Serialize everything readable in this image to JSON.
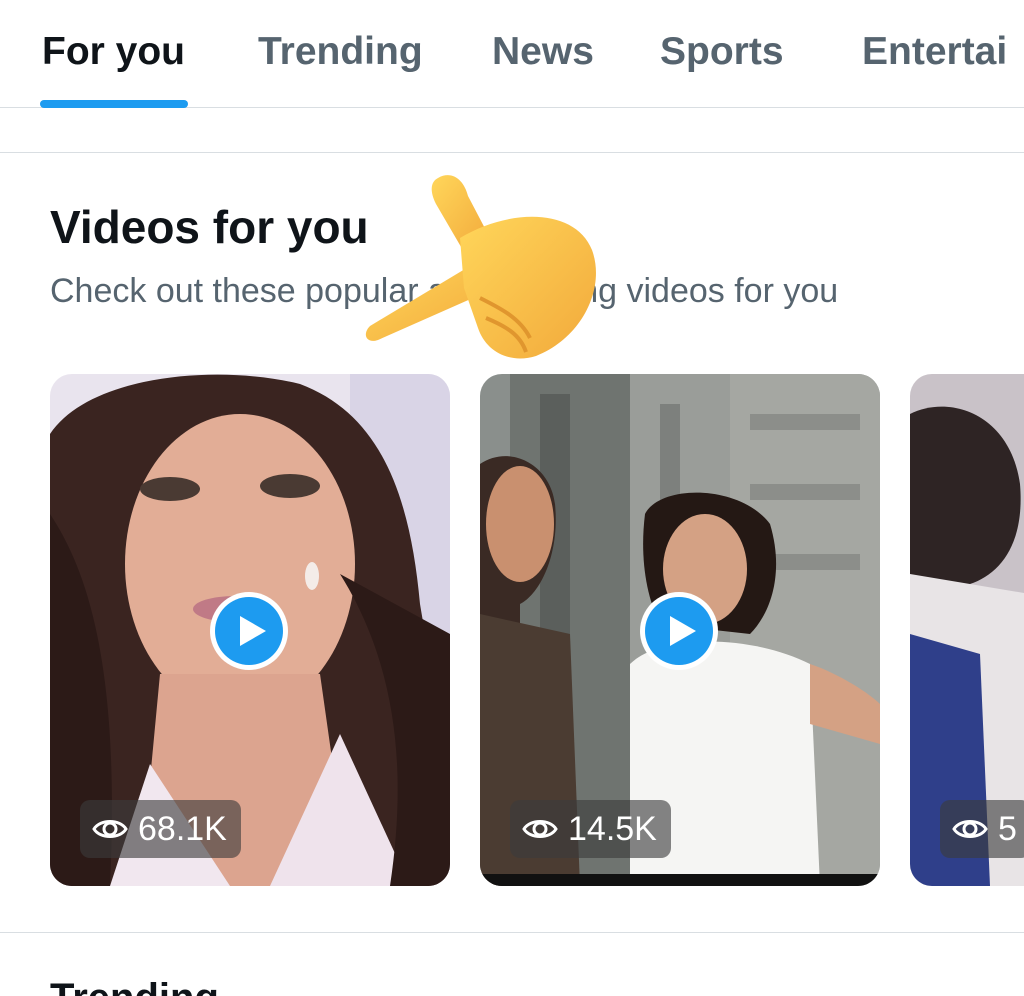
{
  "tabs": [
    {
      "label": "For you",
      "active": true
    },
    {
      "label": "Trending",
      "active": false
    },
    {
      "label": "News",
      "active": false
    },
    {
      "label": "Sports",
      "active": false
    },
    {
      "label": "Entertai",
      "active": false
    }
  ],
  "section": {
    "title": "Videos for you",
    "subtitle": "Check out these popular and trending videos for you"
  },
  "videos": [
    {
      "views": "68.1K",
      "icon": "eye-icon"
    },
    {
      "views": "14.5K",
      "icon": "eye-icon"
    },
    {
      "views": "5",
      "icon": "eye-icon"
    }
  ],
  "next_section": {
    "title": "Trending"
  },
  "colors": {
    "accent": "#1d9bf0",
    "text_primary": "#0f1419",
    "text_secondary": "#56646f"
  }
}
